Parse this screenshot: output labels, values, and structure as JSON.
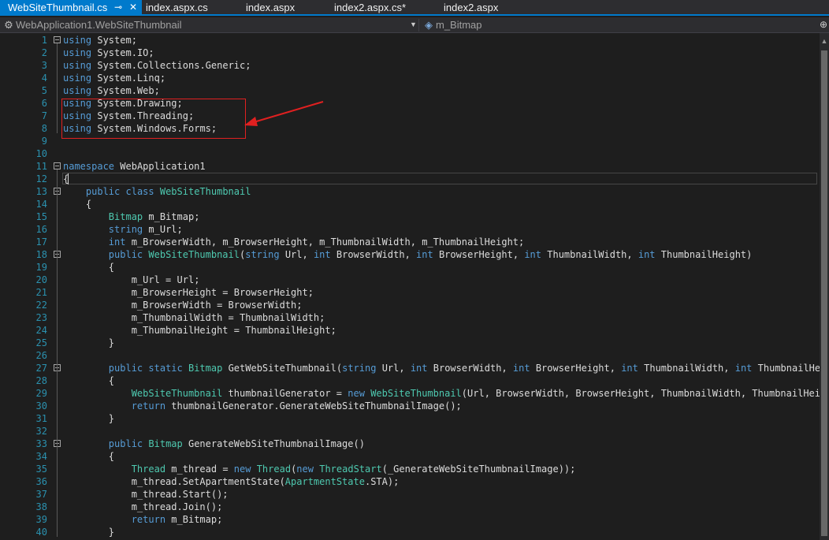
{
  "tabs": [
    {
      "label": "WebSiteThumbnail.cs",
      "active": true,
      "pin_icon": "pin-icon",
      "close_icon": "close-icon"
    },
    {
      "label": "index.aspx.cs"
    },
    {
      "label": "index.aspx"
    },
    {
      "label": "index2.aspx.cs*"
    },
    {
      "label": "index2.aspx"
    }
  ],
  "navbar": {
    "project": "WebApplication1.WebSiteThumbnail",
    "member": "m_Bitmap"
  },
  "lines": [
    {
      "n": "1",
      "t": "using System;"
    },
    {
      "n": "2",
      "t": "using System.IO;"
    },
    {
      "n": "3",
      "t": "using System.Collections.Generic;"
    },
    {
      "n": "4",
      "t": "using System.Linq;"
    },
    {
      "n": "5",
      "t": "using System.Web;"
    },
    {
      "n": "6",
      "t": "using System.Drawing;"
    },
    {
      "n": "7",
      "t": "using System.Threading;"
    },
    {
      "n": "8",
      "t": "using System.Windows.Forms;"
    },
    {
      "n": "9",
      "t": ""
    },
    {
      "n": "10",
      "t": ""
    },
    {
      "n": "11",
      "t": "namespace WebApplication1"
    },
    {
      "n": "12",
      "t": "{"
    },
    {
      "n": "13",
      "t": "    public class WebSiteThumbnail"
    },
    {
      "n": "14",
      "t": "    {"
    },
    {
      "n": "15",
      "t": "        Bitmap m_Bitmap;"
    },
    {
      "n": "16",
      "t": "        string m_Url;"
    },
    {
      "n": "17",
      "t": "        int m_BrowserWidth, m_BrowserHeight, m_ThumbnailWidth, m_ThumbnailHeight;"
    },
    {
      "n": "18",
      "t": "        public WebSiteThumbnail(string Url, int BrowserWidth, int BrowserHeight, int ThumbnailWidth, int ThumbnailHeight)"
    },
    {
      "n": "19",
      "t": "        {"
    },
    {
      "n": "20",
      "t": "            m_Url = Url;"
    },
    {
      "n": "21",
      "t": "            m_BrowserHeight = BrowserHeight;"
    },
    {
      "n": "22",
      "t": "            m_BrowserWidth = BrowserWidth;"
    },
    {
      "n": "23",
      "t": "            m_ThumbnailWidth = ThumbnailWidth;"
    },
    {
      "n": "24",
      "t": "            m_ThumbnailHeight = ThumbnailHeight;"
    },
    {
      "n": "25",
      "t": "        }"
    },
    {
      "n": "26",
      "t": ""
    },
    {
      "n": "27",
      "t": "        public static Bitmap GetWebSiteThumbnail(string Url, int BrowserWidth, int BrowserHeight, int ThumbnailWidth, int ThumbnailHeight"
    },
    {
      "n": "28",
      "t": "        {"
    },
    {
      "n": "29",
      "t": "            WebSiteThumbnail thumbnailGenerator = new WebSiteThumbnail(Url, BrowserWidth, BrowserHeight, ThumbnailWidth, ThumbnailHeight)"
    },
    {
      "n": "30",
      "t": "            return thumbnailGenerator.GenerateWebSiteThumbnailImage();"
    },
    {
      "n": "31",
      "t": "        }"
    },
    {
      "n": "32",
      "t": ""
    },
    {
      "n": "33",
      "t": "        public Bitmap GenerateWebSiteThumbnailImage()"
    },
    {
      "n": "34",
      "t": "        {"
    },
    {
      "n": "35",
      "t": "            Thread m_thread = new Thread(new ThreadStart(_GenerateWebSiteThumbnailImage));"
    },
    {
      "n": "36",
      "t": "            m_thread.SetApartmentState(ApartmentState.STA);"
    },
    {
      "n": "37",
      "t": "            m_thread.Start();"
    },
    {
      "n": "38",
      "t": "            m_thread.Join();"
    },
    {
      "n": "39",
      "t": "            return m_Bitmap;"
    },
    {
      "n": "40",
      "t": "        }"
    }
  ],
  "keywords": [
    "using",
    "namespace",
    "public",
    "class",
    "string",
    "int",
    "static",
    "new",
    "return"
  ],
  "types": [
    "WebSiteThumbnail",
    "Bitmap",
    "Thread",
    "ThreadStart",
    "ApartmentState"
  ],
  "colors": {
    "keyword": "#569cd6",
    "type": "#4ec9b0",
    "text": "#dcdcdc",
    "line_number": "#2b91af",
    "accent": "#007acc",
    "annotation": "#e02020"
  }
}
